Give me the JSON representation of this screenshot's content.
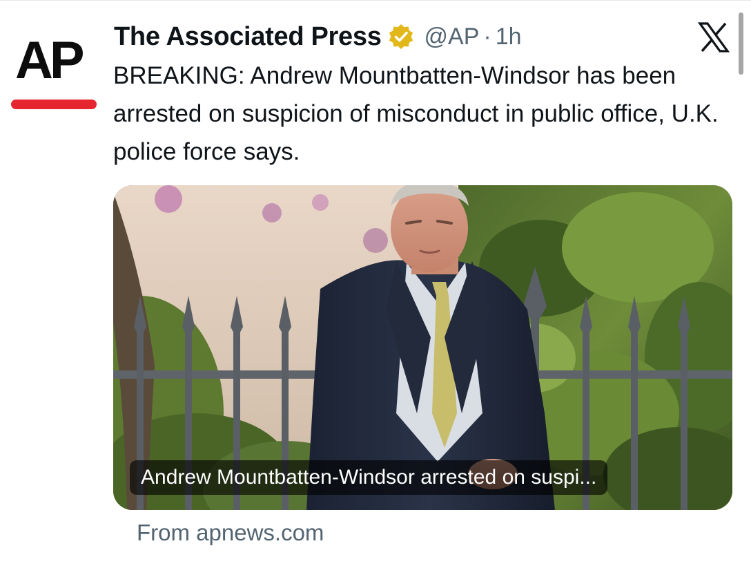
{
  "post": {
    "avatar": {
      "logo_text": "AP",
      "bar_color": "#e5262e"
    },
    "author": {
      "display_name": "The Associated Press",
      "verified_badge": "gold-checkmark-badge-icon",
      "handle": "@AP",
      "separator": "·",
      "timestamp": "1h"
    },
    "platform_icon": "x-logo-icon",
    "text": "BREAKING: Andrew Mountbatten-Windsor has been arrested on suspicion of misconduct in public office, U.K. police force says.",
    "link_card": {
      "image": "photo of man in dark suit and yellow tie in front of iron fence and foliage",
      "caption": "Andrew Mountbatten-Windsor arrested on suspi...",
      "source": "From apnews.com"
    }
  },
  "colors": {
    "text_primary": "#0f1419",
    "text_secondary": "#536471",
    "verified_gold": "#e2b719",
    "ap_red": "#e5262e"
  }
}
